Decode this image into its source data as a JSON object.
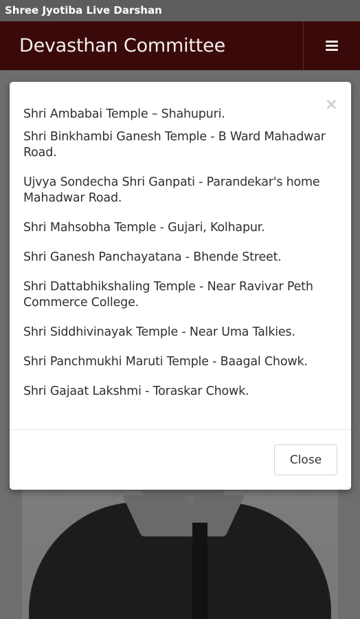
{
  "status_bar": {
    "app_name": "Shree Jyotiba Live Darshan"
  },
  "header": {
    "title": "Devasthan Committee",
    "menu_icon": "hamburger-menu-icon"
  },
  "modal": {
    "close_glyph": "×",
    "items": [
      "Shri Ambabai Temple – Shahupuri.",
      "Shri Binkhambi Ganesh Temple - B Ward Mahadwar Road.",
      "Ujvya Sondecha Shri Ganpati - Parandekar's home Mahadwar Road.",
      "Shri Mahsobha Temple - Gujari, Kolhapur.",
      "Shri Ganesh Panchayatana - Bhende Street.",
      "Shri Dattabhikshaling Temple - Near Ravivar Peth Commerce College.",
      "Shri Siddhivinayak Temple - Near Uma Talkies.",
      "Shri Panchmukhi Maruti Temple - Baagal Chowk.",
      "Shri Gajaat Lakshmi - Toraskar Chowk."
    ],
    "close_label": "Close"
  },
  "colors": {
    "header_bg": "#3a0a0a",
    "status_bar_bg": "#5d5d5d",
    "backdrop": "#6e6e6e"
  }
}
